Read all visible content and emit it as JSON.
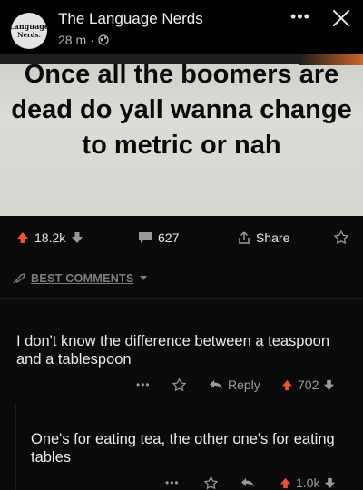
{
  "header": {
    "avatar_text_line1": "Language",
    "avatar_text_line2": "Nerds.",
    "page_name": "The Language Nerds",
    "timestamp": "28 m",
    "meta_separator": "·",
    "more_label": "•••"
  },
  "post": {
    "title": "Once all the boomers are dead do yall wanna change to metric or nah",
    "upvotes": "18.2k",
    "comments": "627",
    "share_label": "Share",
    "best_comments_label": "BEST COMMENTS"
  },
  "comments": [
    {
      "text": "I don't know the difference between a teaspoon and a tablespoon",
      "more": "•••",
      "reply_label": "Reply",
      "votes": "702"
    },
    {
      "text": "One's for eating tea, the other one's for eating tables",
      "more": "•••",
      "votes": "1.0k"
    }
  ],
  "colors": {
    "background": "#000000",
    "vote_red": "#e8533a",
    "meme_bg": "#d8d8d2"
  },
  "icons": [
    "globe-icon",
    "more-icon",
    "close-icon",
    "upvote-icon",
    "downvote-icon",
    "comment-icon",
    "share-icon",
    "award-icon",
    "reply-icon",
    "sort-chevron-icon"
  ]
}
